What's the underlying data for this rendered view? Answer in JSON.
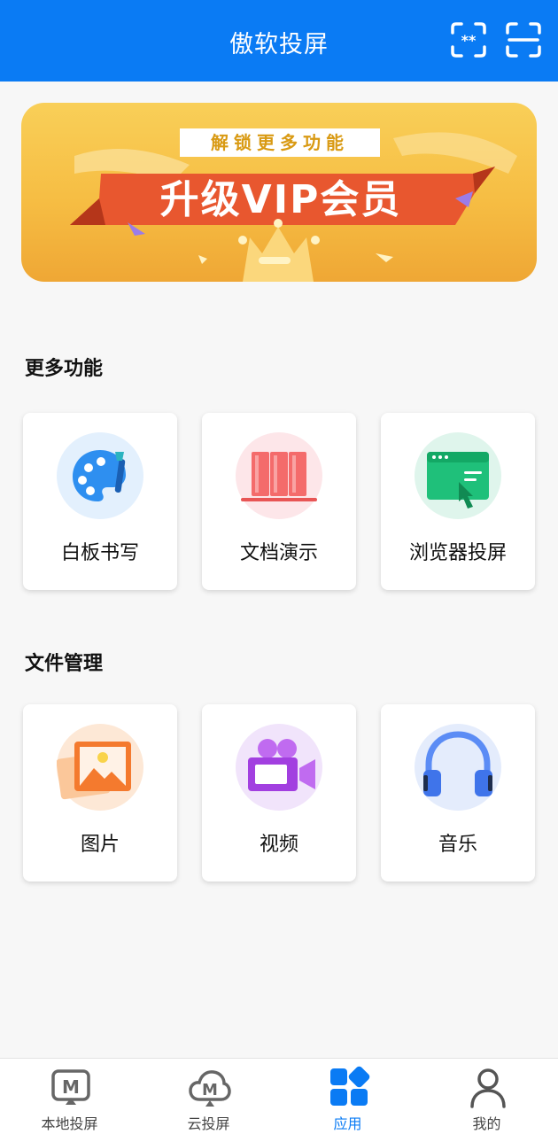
{
  "header": {
    "title": "傲软投屏",
    "icons": [
      "pin-code-scan-icon",
      "qr-scan-icon"
    ]
  },
  "banner": {
    "subtitle": "解锁更多功能",
    "headline": "升级VIP会员"
  },
  "sections": [
    {
      "title": "更多功能",
      "items": [
        {
          "label": "白板书写",
          "icon": "palette-icon"
        },
        {
          "label": "文档演示",
          "icon": "documents-icon"
        },
        {
          "label": "浏览器投屏",
          "icon": "browser-cursor-icon"
        }
      ]
    },
    {
      "title": "文件管理",
      "items": [
        {
          "label": "图片",
          "icon": "image-icon"
        },
        {
          "label": "视频",
          "icon": "video-camera-icon"
        },
        {
          "label": "音乐",
          "icon": "headphones-icon"
        }
      ]
    }
  ],
  "bottom_nav": {
    "active_index": 2,
    "items": [
      {
        "label": "本地投屏",
        "icon": "local-cast-icon"
      },
      {
        "label": "云投屏",
        "icon": "cloud-cast-icon"
      },
      {
        "label": "应用",
        "icon": "apps-grid-icon"
      },
      {
        "label": "我的",
        "icon": "profile-icon"
      }
    ]
  },
  "colors": {
    "primary": "#0a7bf4",
    "banner_gold": "#f6bd43",
    "ribbon_orange": "#e8572f"
  }
}
